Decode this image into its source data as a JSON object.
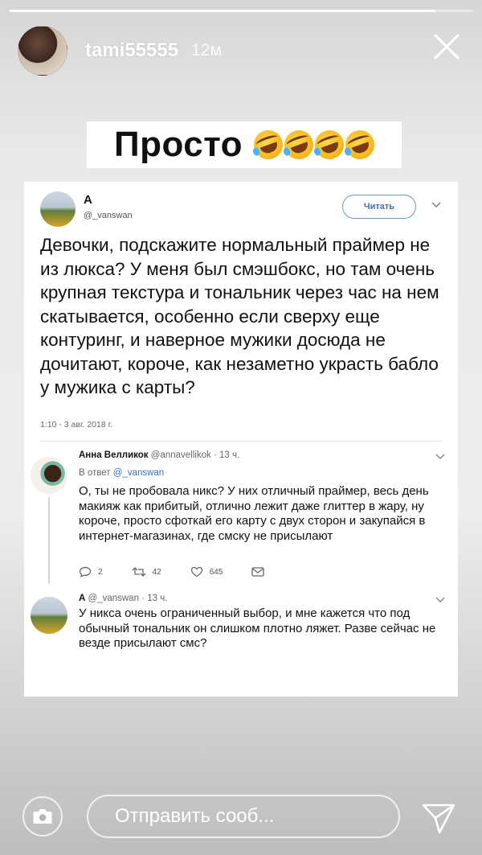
{
  "story": {
    "progress": 0.92,
    "username": "tami55555",
    "time": "12м",
    "caption": "Просто",
    "caption_emoji_count": 4,
    "caption_emoji_icon": "rolling-on-floor-laughing-emoji"
  },
  "tweet": {
    "name": "A",
    "handle": "@_vanswan",
    "follow_label": "Читать",
    "text": "Девочки, подскажите нормальный праймер не из люкса? У меня был смэшбокс,  но там очень крупная текстура и тональник через час на нем скатывается,  особенно если сверху еще контуринг, и наверное мужики досюда не дочитают, короче, как незаметно украсть бабло у мужика с карты?",
    "date": "1:10 - 3 авг. 2018 г."
  },
  "replies": [
    {
      "name": "Анна Велликок",
      "handle": "@annavellikok",
      "time": "· 13 ч.",
      "reply_to_prefix": "В ответ",
      "reply_to_handle": "@_vanswan",
      "text": "О, ты не пробовала никс? У них отличный праймер, весь день макияж как прибитый, отлично лежит даже глиттер в жару, ну короче, просто сфоткай его карту с двух сторон и закупайся в интернет-магазинах, где смску не присылают",
      "replies_count": "2",
      "retweets_count": "42",
      "likes_count": "645"
    },
    {
      "name": "A",
      "handle": "@_vanswan",
      "time": "· 13 ч.",
      "text": "У никса очень ограниченный выбор, и мне кажется что под обычный тональник он слишком плотно ляжет. Разве сейчас не везде присылают смс?"
    }
  ],
  "bottom": {
    "message_placeholder": "Отправить сооб..."
  },
  "colors": {
    "accent_blue": "#3d6fae",
    "story_text": "#ffffff"
  }
}
